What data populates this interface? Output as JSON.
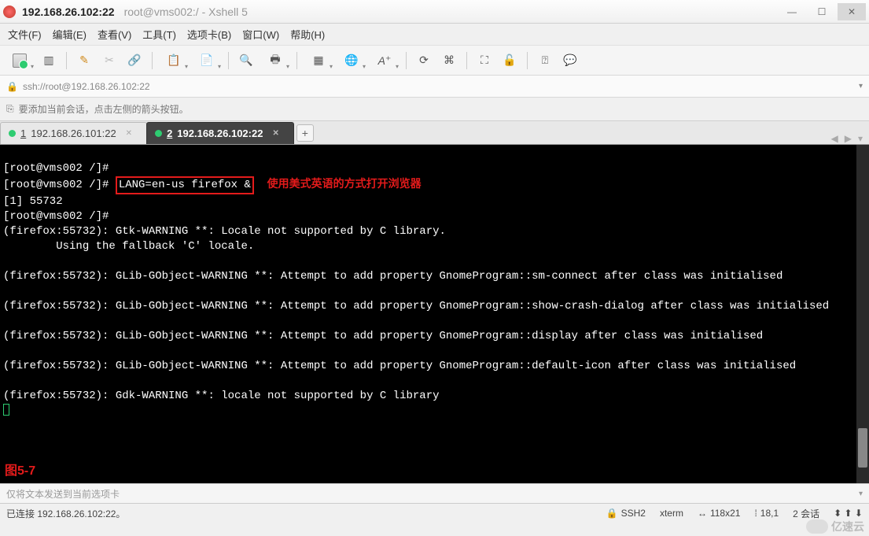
{
  "window": {
    "title_main": "192.168.26.102:22",
    "title_sub": "root@vms002:/ - Xshell 5"
  },
  "menu": {
    "file": "文件(F)",
    "edit": "编辑(E)",
    "view": "查看(V)",
    "tools": "工具(T)",
    "tabs": "选项卡(B)",
    "window": "窗口(W)",
    "help": "帮助(H)"
  },
  "addressbar": {
    "url": "ssh://root@192.168.26.102:22"
  },
  "hintbar": {
    "text": "要添加当前会话，点击左侧的箭头按钮。"
  },
  "tabs": [
    {
      "index": "1",
      "label": "192.168.26.101:22",
      "active": false
    },
    {
      "index": "2",
      "label": "192.168.26.102:22",
      "active": true
    }
  ],
  "terminal": {
    "prompt": "[root@vms002 /]#",
    "highlighted_cmd": "LANG=en-us firefox &",
    "annotation": "使用美式英语的方式打开浏览器",
    "lines_after_cmd": [
      "[1] 55732",
      "[root@vms002 /]#",
      "(firefox:55732): Gtk-WARNING **: Locale not supported by C library.",
      "\tUsing the fallback 'C' locale.",
      "",
      "(firefox:55732): GLib-GObject-WARNING **: Attempt to add property GnomeProgram::sm-connect after class was initialised",
      "",
      "(firefox:55732): GLib-GObject-WARNING **: Attempt to add property GnomeProgram::show-crash-dialog after class was initialised",
      "",
      "(firefox:55732): GLib-GObject-WARNING **: Attempt to add property GnomeProgram::display after class was initialised",
      "",
      "(firefox:55732): GLib-GObject-WARNING **: Attempt to add property GnomeProgram::default-icon after class was initialised",
      "",
      "(firefox:55732): Gdk-WARNING **: locale not supported by C library"
    ],
    "figure_label": "图5-7"
  },
  "sendbar": {
    "placeholder": "仅将文本发送到当前选项卡"
  },
  "statusbar": {
    "conn": "已连接 192.168.26.102:22。",
    "proto_icon": "🔒",
    "proto": "SSH2",
    "term": "xterm",
    "size_icon": "↔",
    "size": "118x21",
    "pos_icon": "⁞",
    "pos": "18,1",
    "sessions": "2 会话",
    "arrows": "⬍  ⬆  ⬇"
  },
  "watermark": "亿速云"
}
